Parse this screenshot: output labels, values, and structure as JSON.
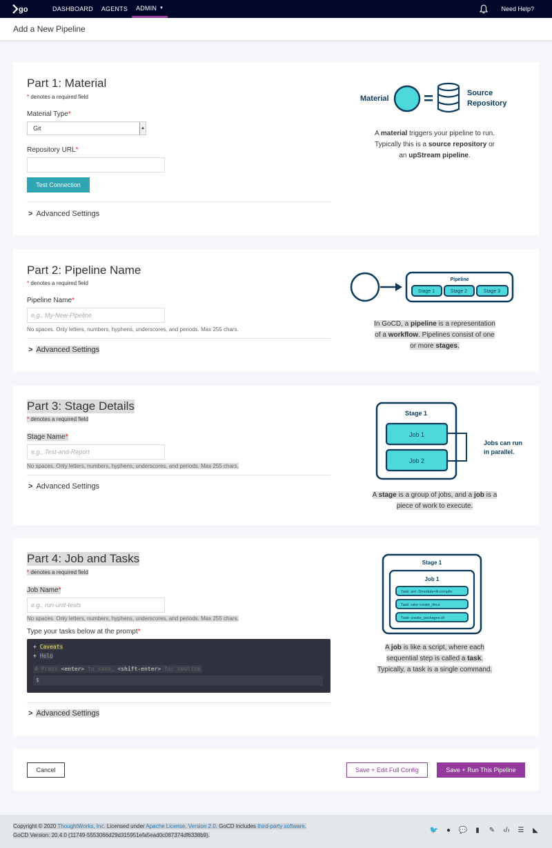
{
  "nav": {
    "logo": "go",
    "links": [
      "DASHBOARD",
      "AGENTS",
      "ADMIN"
    ],
    "help": "Need Help?"
  },
  "page_title": "Add a New Pipeline",
  "part1": {
    "title": "Part 1: Material",
    "required_note": "denotes a required field",
    "material_type_label": "Material Type",
    "material_type_value": "Git",
    "repo_url_label": "Repository URL",
    "test_connection": "Test Connection",
    "advanced": "Advanced Settings",
    "diagram_material": "Material",
    "diagram_source_line1": "Source",
    "diagram_source_line2": "Repository",
    "desc_line1_a": "A ",
    "desc_line1_b": "material",
    "desc_line1_c": " triggers your pipeline to run.",
    "desc_line2_a": "Typically this is a ",
    "desc_line2_b": "source repository",
    "desc_line2_c": " or",
    "desc_line3_a": "an ",
    "desc_line3_b": "upStream pipeline",
    "desc_line3_c": "."
  },
  "part2": {
    "title": "Part 2: Pipeline Name",
    "required_note": "denotes a required field",
    "name_label": "Pipeline Name",
    "name_placeholder": "e.g., My-New-Pipeline",
    "hint": "No spaces. Only letters, numbers, hyphens, underscores, and periods. Max 255 chars.",
    "advanced": "Advanced Settings",
    "diagram_pipeline": "Pipeline",
    "diagram_stages": [
      "Stage 1",
      "Stage 2",
      "Stage 3"
    ],
    "desc_line1_a": "In GoCD, a ",
    "desc_line1_b": "pipeline",
    "desc_line1_c": " is a representation",
    "desc_line2_a": "of a ",
    "desc_line2_b": "workflow",
    "desc_line2_c": ". Pipelines consist of one",
    "desc_line3_a": "or more ",
    "desc_line3_b": "stages",
    "desc_line3_c": "."
  },
  "part3": {
    "title": "Part 3: Stage Details",
    "required_note": "denotes a required field",
    "name_label": "Stage Name",
    "name_placeholder": "e.g., Test-and-Report",
    "hint": "No spaces. Only letters, numbers, hyphens, underscores, and periods. Max 255 chars.",
    "advanced": "Advanced Settings",
    "diagram_stage": "Stage 1",
    "diagram_jobs": [
      "Job 1",
      "Job 2"
    ],
    "diagram_note_line1": "Jobs can run",
    "diagram_note_line2": "in parallel.",
    "desc_line1_a": "A ",
    "desc_line1_b": "stage",
    "desc_line1_c": " is a group of jobs, and a ",
    "desc_line1_d": "job",
    "desc_line1_e": " is a",
    "desc_line2": "piece of work to execute."
  },
  "part4": {
    "title": "Part 4: Job and Tasks",
    "required_note": "denotes a required field",
    "name_label": "Job Name",
    "name_placeholder": "e.g., run-unit-tests",
    "hint": "No spaces. Only letters, numbers, hyphens, underscores, and periods. Max 255 chars.",
    "tasks_label": "Type your tasks below at the prompt",
    "terminal_caveats": "Caveats",
    "terminal_help": "Help",
    "terminal_hint_a": "# Press ",
    "terminal_hint_enter": "<enter>",
    "terminal_hint_b": " to save, ",
    "terminal_hint_shift": "<shift-enter>",
    "terminal_hint_c": " for newline",
    "terminal_prompt": "$",
    "advanced": "Advanced Settings",
    "diagram_stage": "Stage 1",
    "diagram_job": "Job 1",
    "diagram_tasks": [
      "Task: ant -Dmodule=A compile",
      "Task: rake create_docs",
      "Task: create_packages.sh"
    ],
    "desc_line1_a": "A ",
    "desc_line1_b": "job",
    "desc_line1_c": " is like a script, where each",
    "desc_line2_a": "sequential step is called a ",
    "desc_line2_b": "task",
    "desc_line2_c": ".",
    "desc_line3": "Typically, a task is a single command."
  },
  "actions": {
    "cancel": "Cancel",
    "save_edit": "Save + Edit Full Config",
    "save_run": "Save + Run This Pipeline"
  },
  "footer": {
    "copyright": "Copyright © 2020 ",
    "company": "ThoughtWorks, Inc.",
    "licensed": " Licensed under ",
    "license": "Apache License, Version 2.0",
    "includes": ". GoCD includes ",
    "thirdparty": "third-party software",
    "dot": ".",
    "version": "GoCD Version: 20.4.0 (11749-5553066d29d315951efa5ead0c087374df6338b9)."
  },
  "colors": {
    "nav_bg": "#000728",
    "accent_purple": "#943a9e",
    "teal": "#2fa4b3",
    "diagram_navy": "#0a3a5a",
    "diagram_cyan": "#4dd9dc"
  }
}
